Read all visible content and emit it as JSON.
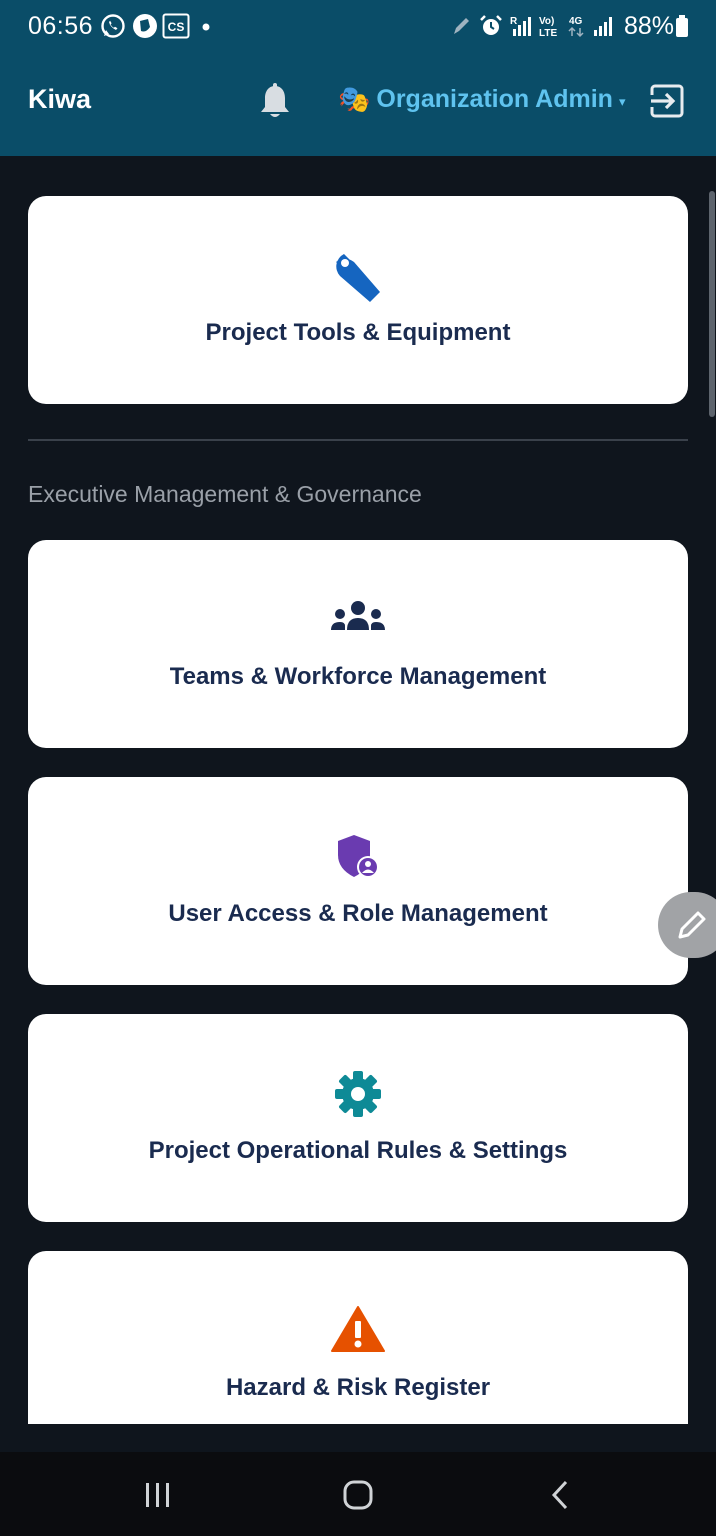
{
  "status_bar": {
    "time": "06:56",
    "battery": "88%",
    "left_icons": [
      "whatsapp-icon",
      "shield-app-icon",
      "cs-icon",
      "dot-icon"
    ],
    "right_icons": [
      "edit-icon",
      "alarm-icon",
      "signal-r-icon",
      "volte-icon",
      "4g-icon",
      "signal-icon",
      "battery-icon"
    ],
    "cs_text": "CS",
    "volte_text": "Vo)\nLTE",
    "net_text": "4G"
  },
  "app_bar": {
    "title": "Kiwa",
    "role_emoji": "🎭",
    "role": "Organization Admin",
    "caret": "▾"
  },
  "cards": [
    {
      "label": "Project Tools & Equipment",
      "icon": "wrench-icon",
      "color": "#1565c0"
    },
    {
      "label": "Teams & Workforce Management",
      "icon": "users-group-icon",
      "color": "#1a2b4f"
    },
    {
      "label": "User Access & Role Management",
      "icon": "shield-user-icon",
      "color": "#6a3bb0"
    },
    {
      "label": "Project Operational Rules & Settings",
      "icon": "gear-icon",
      "color": "#0e8a96"
    },
    {
      "label": "Hazard & Risk Register",
      "icon": "warning-icon",
      "color": "#e65100"
    }
  ],
  "section_heading": "Executive Management & Governance",
  "colors": {
    "header": "#0a4d68",
    "background": "#0f151d",
    "role_accent": "#5fc3ef",
    "card_text": "#1a2b4f"
  }
}
